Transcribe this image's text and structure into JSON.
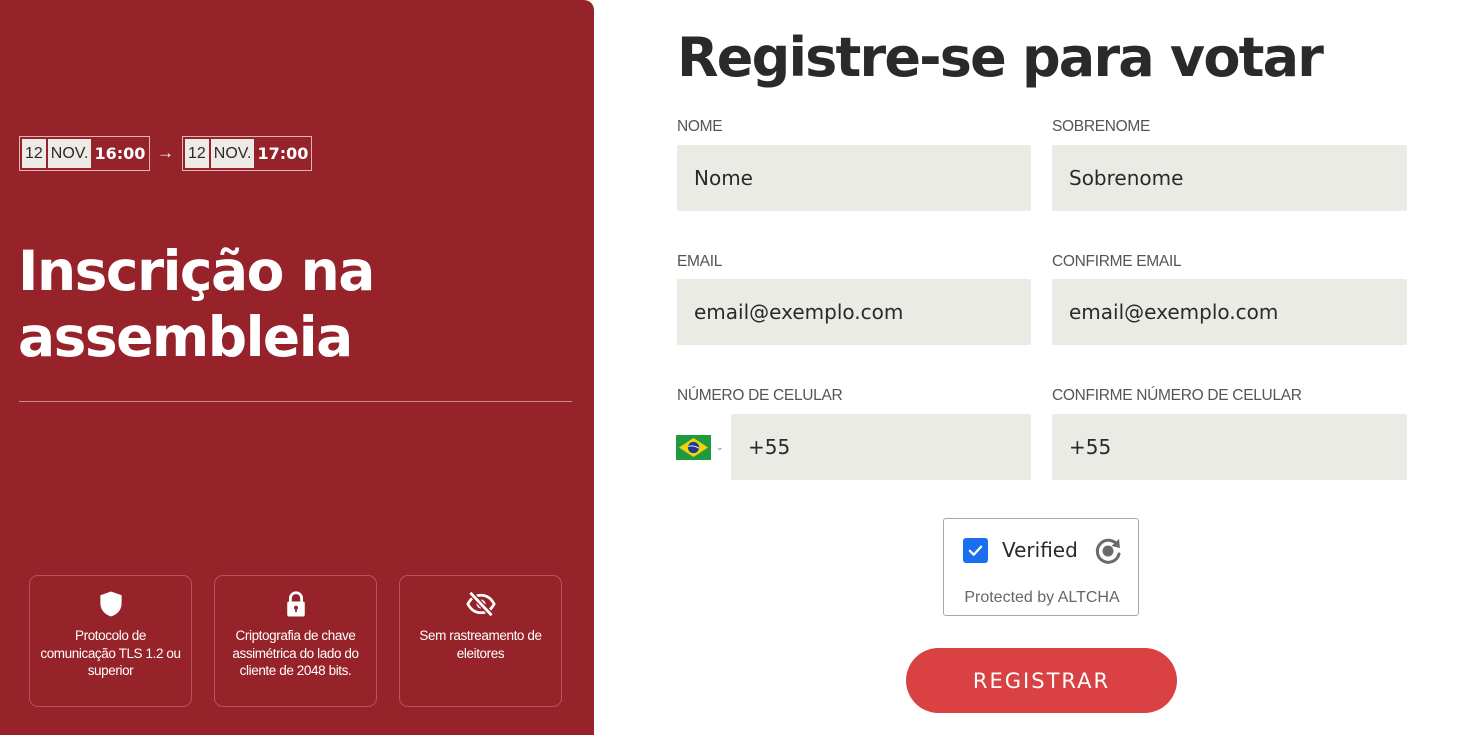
{
  "event": {
    "start": {
      "day": "12",
      "month": "NOV.",
      "time": "16:00"
    },
    "end": {
      "day": "12",
      "month": "NOV.",
      "time": "17:00"
    },
    "arrow": "→",
    "title_line1": "Inscrição na",
    "title_line2": "assembleia"
  },
  "features": [
    {
      "icon": "shield-icon",
      "text": "Protocolo de comunicação TLS 1.2 ou superior"
    },
    {
      "icon": "lock-icon",
      "text": "Criptografia de chave assimétrica do lado do cliente de 2048 bits."
    },
    {
      "icon": "eye-off-icon",
      "text": "Sem rastreamento de eleitores"
    }
  ],
  "form": {
    "title": "Registre-se para votar",
    "first_name": {
      "label": "NOME",
      "placeholder": "Nome"
    },
    "last_name": {
      "label": "SOBRENOME",
      "placeholder": "Sobrenome"
    },
    "email": {
      "label": "EMAIL",
      "placeholder": "email@exemplo.com"
    },
    "email_confirm": {
      "label": "CONFIRME EMAIL",
      "placeholder": "email@exemplo.com"
    },
    "phone": {
      "label": "NÚMERO DE CELULAR",
      "value": "+55",
      "country_icon": "brazil-flag-icon"
    },
    "phone_confirm": {
      "label": "CONFIRME NÚMERO DE CELULAR",
      "value": "+55"
    },
    "captcha": {
      "label": "Verified",
      "footer": "Protected by ALTCHA",
      "checked": true
    },
    "submit_label": "REGISTRAR"
  },
  "colors": {
    "panel": "#96222a",
    "button": "#d94142",
    "input_bg": "#ebebe6",
    "checkbox": "#1a6ef0"
  }
}
